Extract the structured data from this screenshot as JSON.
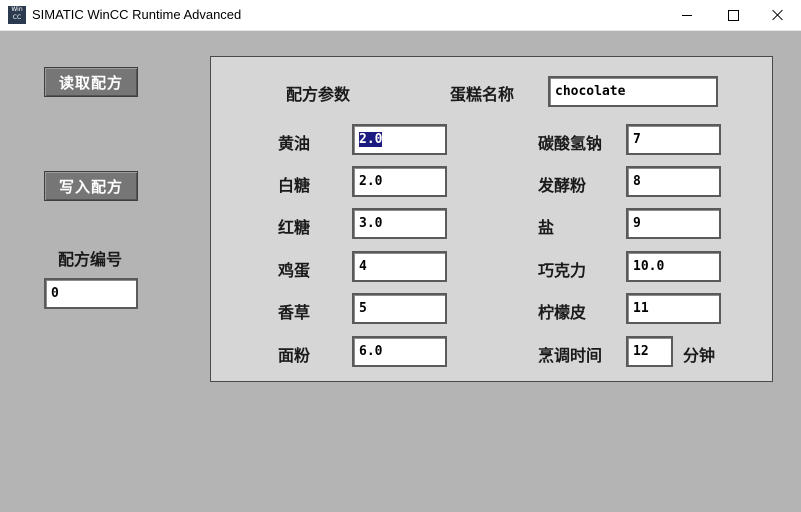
{
  "window": {
    "title": "SIMATIC WinCC Runtime Advanced",
    "icon_name": "wincc-app-icon",
    "icon_text": [
      "Win",
      "CC",
      "RTA"
    ],
    "background_color": "#b4b4b4"
  },
  "left": {
    "read_button": "读取配方",
    "write_button": "写入配方",
    "recipe_number_label": "配方编号",
    "recipe_number_value": "0"
  },
  "panel": {
    "recipe_params_label": "配方参数",
    "cake_name_label": "蛋糕名称",
    "cake_name_value": "chocolate",
    "left_params": [
      {
        "label": "黄油",
        "value": "2.0",
        "selected": true
      },
      {
        "label": "白糖",
        "value": "2.0"
      },
      {
        "label": "红糖",
        "value": "3.0"
      },
      {
        "label": "鸡蛋",
        "value": "4"
      },
      {
        "label": "香草",
        "value": "5"
      },
      {
        "label": "面粉",
        "value": "6.0"
      }
    ],
    "right_params": [
      {
        "label": "碳酸氢钠",
        "value": "7"
      },
      {
        "label": "发酵粉",
        "value": "8"
      },
      {
        "label": "盐",
        "value": "9"
      },
      {
        "label": "巧克力",
        "value": "10.0"
      },
      {
        "label": "柠檬皮",
        "value": "11"
      },
      {
        "label": "烹调时间",
        "value": "12",
        "unit": "分钟"
      }
    ]
  }
}
